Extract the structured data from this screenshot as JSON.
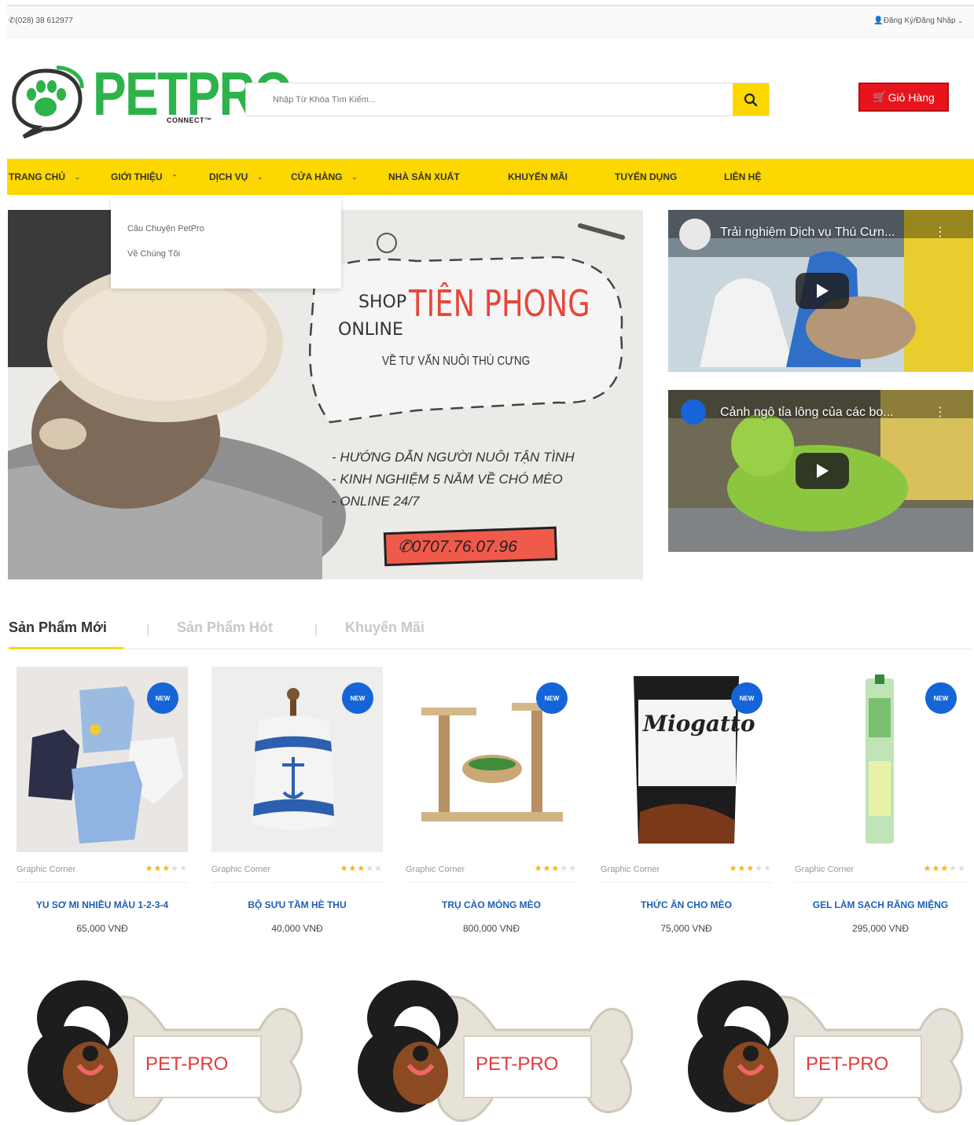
{
  "topbar": {
    "phone": "(028) 38 612977",
    "account": "Đăng Ký/Đăng Nhập"
  },
  "logo": {
    "text": "PETPRO",
    "sub": "CONNECT™"
  },
  "search": {
    "placeholder": "Nhập Từ Khóa Tìm Kiếm..."
  },
  "cart": {
    "label": "Giỏ Hàng"
  },
  "nav": {
    "items": [
      {
        "label": "TRANG CHỦ"
      },
      {
        "label": "GIỚI THIỆU"
      },
      {
        "label": "DỊCH VỤ"
      },
      {
        "label": "CỬA HÀNG"
      },
      {
        "label": "NHÀ SẢN XUẤT"
      },
      {
        "label": "KHUYẾN MÃI"
      },
      {
        "label": "TUYỂN DỤNG"
      },
      {
        "label": "LIÊN HỆ"
      }
    ]
  },
  "dropdown": {
    "items": [
      "Câu Chuyện PetPro",
      "Về Chúng Tôi"
    ]
  },
  "banner": {
    "shop": "SHOP",
    "online": "ONLINE",
    "headline": "TIÊN PHONG",
    "sub": "VỀ TƯ VẤN NUÔI THÚ CƯNG",
    "bullets": [
      "- HƯỚNG DẪN NGƯỜI NUÔI TẬN TÌNH",
      "- KINH NGHIỆM 5 NĂM VỀ CHÓ MÈO",
      "- ONLINE 24/7"
    ],
    "hotline": "0707.76.07.96"
  },
  "videos": [
    {
      "title": "Trải nghiệm Dịch vụ Thú Cưn..."
    },
    {
      "title": "Cảnh ngộ tỉa lông của các bo..."
    }
  ],
  "tabs": {
    "items": [
      "Sản Phẩm Mới",
      "Sản Phẩm Hót",
      "Khuyến Mãi"
    ],
    "separator": "|"
  },
  "products": [
    {
      "name": "YU SƠ MI NHIỀU MÀU 1-2-3-4",
      "price": "65,000 VNĐ",
      "brand": "Graphic Corner",
      "badge": "NEW",
      "rating": 3
    },
    {
      "name": "BỘ SƯU TẦM HÈ THU",
      "price": "40,000 VNĐ",
      "brand": "Graphic Corner",
      "badge": "NEW",
      "rating": 3
    },
    {
      "name": "TRỤ CÀO MÓNG MÈO",
      "price": "800,000 VNĐ",
      "brand": "Graphic Corner",
      "badge": "NEW",
      "rating": 3
    },
    {
      "name": "THỨC ĂN CHO MÈO",
      "price": "75,000 VNĐ",
      "brand": "Graphic Corner",
      "badge": "NEW",
      "rating": 3
    },
    {
      "name": "GEL LÀM SẠCH RĂNG MIỆNG",
      "price": "295,000 VNĐ",
      "brand": "Graphic Corner",
      "badge": "NEW",
      "rating": 3
    }
  ],
  "product_images": {
    "4": "Miogatto"
  },
  "promos": [
    {
      "label": "PET-PRO"
    },
    {
      "label": "PET-PRO"
    },
    {
      "label": "PET-PRO"
    }
  ],
  "colors": {
    "accent_yellow": "#fcd800",
    "cart_red": "#e8141c",
    "badge_blue": "#1565d8",
    "logo_green": "#2db34a",
    "product_name_blue": "#1e5fb4"
  }
}
